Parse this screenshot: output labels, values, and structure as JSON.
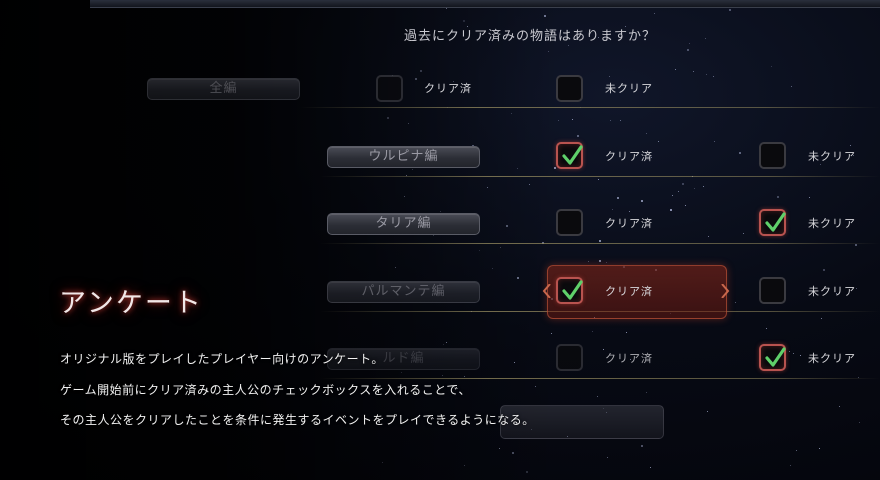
{
  "question": "過去にクリア済みの物語はありますか？",
  "rows": [
    {
      "name": "全編",
      "option_a": {
        "label": "クリア済",
        "checked": false
      },
      "option_b": {
        "label": "未クリア",
        "checked": false
      }
    },
    {
      "name": "ウルピナ編",
      "option_a": {
        "label": "クリア済",
        "checked": true
      },
      "option_b": {
        "label": "未クリア",
        "checked": false
      }
    },
    {
      "name": "タリア編",
      "option_a": {
        "label": "クリア済",
        "checked": false
      },
      "option_b": {
        "label": "未クリア",
        "checked": true
      }
    },
    {
      "name": "パルマンテ編",
      "option_a": {
        "label": "クリア済",
        "checked": true
      },
      "option_b": {
        "label": "未クリア",
        "checked": false
      },
      "selected": true
    },
    {
      "name": "ルド編",
      "option_a": {
        "label": "クリア済",
        "checked": false
      },
      "option_b": {
        "label": "未クリア",
        "checked": true
      }
    }
  ],
  "survey": {
    "title": "アンケート",
    "lines": [
      "オリジナル版をプレイしたプレイヤー向けのアンケート。",
      "ゲーム開始前にクリア済みの主人公のチェックボックスを入れることで、",
      "その主人公をクリアしたことを条件に発生するイベントをプレイできるようになる。"
    ]
  },
  "colors": {
    "accent": "#b8534f",
    "check": "#5fd06a",
    "divider": "#968c5f"
  },
  "icons": {
    "check": "checkmark-icon",
    "cursor_arrows": "cursor-arrow-icon"
  }
}
